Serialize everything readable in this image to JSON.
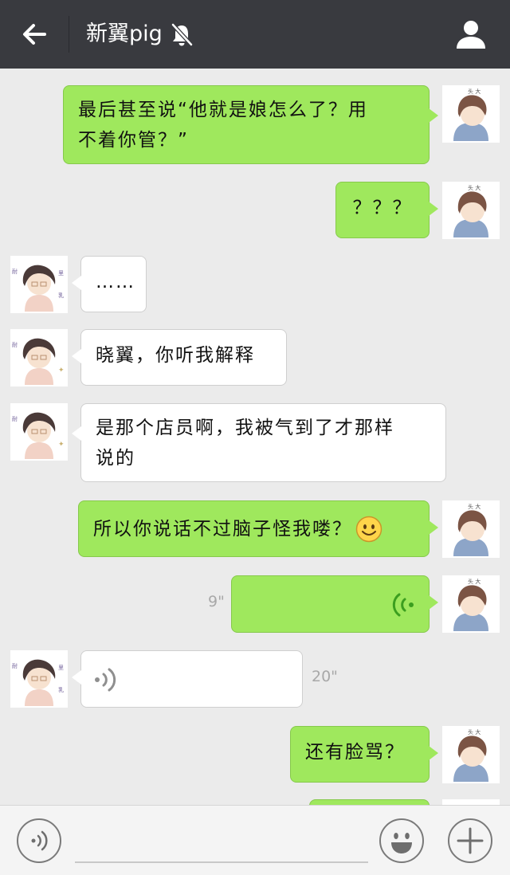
{
  "header": {
    "title": "新翼pig",
    "back_icon": "arrow-left-icon",
    "mute_icon": "bell-muted-icon",
    "profile_icon": "person-icon"
  },
  "messages": [
    {
      "side": "me",
      "type": "text",
      "text_lines": [
        "最后甚至说“他就是娘怎么了？用",
        "不着你管？”"
      ]
    },
    {
      "side": "me",
      "type": "text",
      "text": "？？？"
    },
    {
      "side": "them",
      "type": "text",
      "text": "……"
    },
    {
      "side": "them",
      "type": "text",
      "text": "晓翼，你听我解释"
    },
    {
      "side": "them",
      "type": "text",
      "text_lines": [
        "是那个店员啊，我被气到了才那样",
        "说的"
      ]
    },
    {
      "side": "me",
      "type": "text",
      "text": "所以你说话不过脑子怪我喽？",
      "emoji": "smiley-emoji-icon"
    },
    {
      "side": "me",
      "type": "voice",
      "duration": "9\""
    },
    {
      "side": "them",
      "type": "voice",
      "duration": "20\""
    },
    {
      "side": "me",
      "type": "text",
      "text": "还有脸骂？"
    }
  ],
  "bottom": {
    "voice_icon": "voice-input-icon",
    "emoji_icon": "emoji-face-icon",
    "plus_icon": "plus-icon"
  },
  "colors": {
    "topbar": "#393a3f",
    "me_bubble": "#9fe85d",
    "them_bubble": "#ffffff",
    "background": "#ebebeb"
  }
}
